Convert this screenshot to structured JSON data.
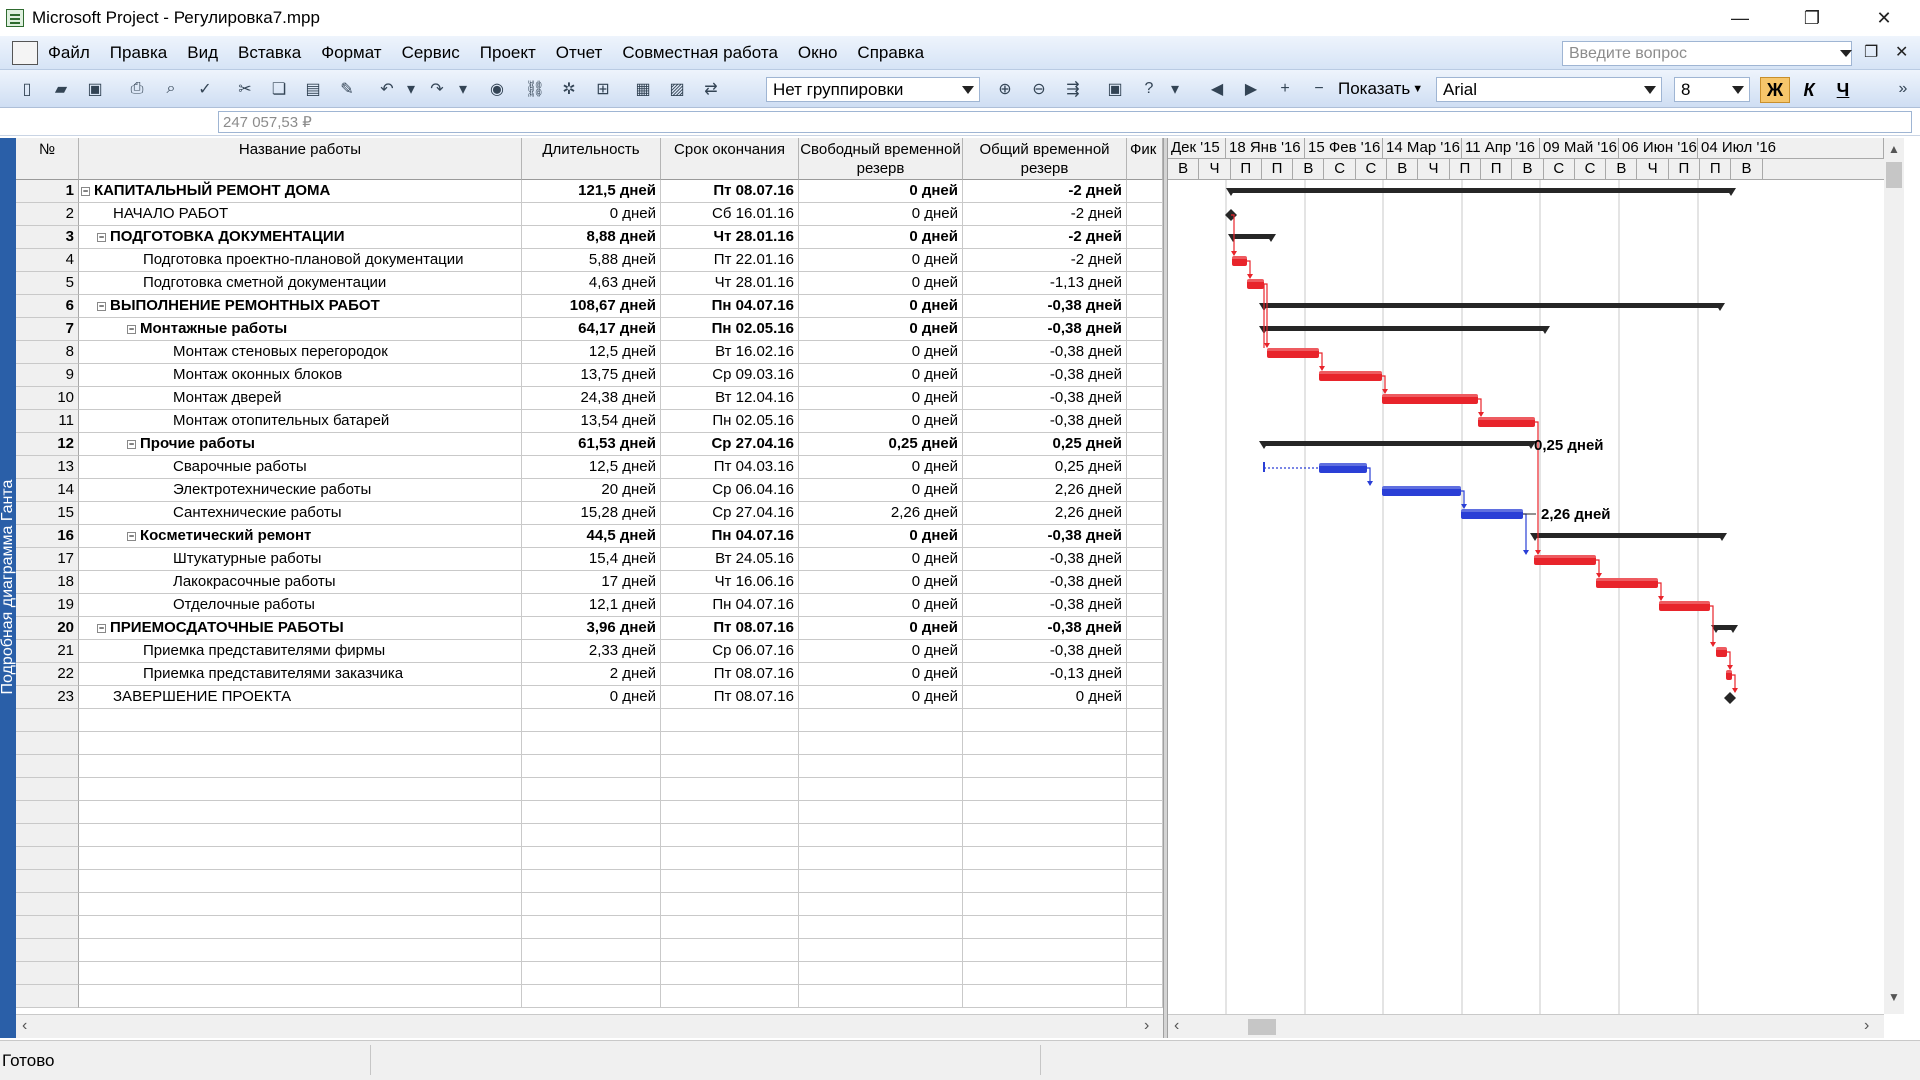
{
  "window": {
    "title": "Microsoft Project - Регулировка7.mpp",
    "buttons": [
      "—",
      "❐",
      "✕"
    ]
  },
  "menu": {
    "items": [
      "Файл",
      "Правка",
      "Вид",
      "Вставка",
      "Формат",
      "Сервис",
      "Проект",
      "Отчет",
      "Совместная работа",
      "Окно",
      "Справка"
    ],
    "ask_placeholder": "Введите вопрос"
  },
  "toolbar": {
    "grouping": "Нет группировки",
    "show_label": "Показать",
    "font_name": "Arial",
    "font_size": "8",
    "bold": "Ж",
    "italic": "К",
    "underline": "Ч"
  },
  "entry_bar": {
    "value": "247 057,53 ₽"
  },
  "view_bar": {
    "label": "Подробная диаграмма Ганта"
  },
  "grid": {
    "columns": [
      "№",
      "Название работы",
      "Длительность",
      "Срок окончания",
      "Свободный временной резерв",
      "Общий временной резерв",
      "Фик"
    ],
    "rows": [
      {
        "id": "1",
        "name": "КАПИТАЛЬНЫЙ РЕМОНТ ДОМА",
        "duration": "121,5 дней",
        "finish": "Пт 08.07.16",
        "free_slack": "0 дней",
        "total_slack": "-2 дней",
        "level": 0,
        "summary": true
      },
      {
        "id": "2",
        "name": "НАЧАЛО РАБОТ",
        "duration": "0 дней",
        "finish": "Сб 16.01.16",
        "free_slack": "0 дней",
        "total_slack": "-2 дней",
        "level": 1,
        "summary": false
      },
      {
        "id": "3",
        "name": "ПОДГОТОВКА ДОКУМЕНТАЦИИ",
        "duration": "8,88 дней",
        "finish": "Чт 28.01.16",
        "free_slack": "0 дней",
        "total_slack": "-2 дней",
        "level": 1,
        "summary": true
      },
      {
        "id": "4",
        "name": "Подготовка проектно-плановой документации",
        "duration": "5,88 дней",
        "finish": "Пт 22.01.16",
        "free_slack": "0 дней",
        "total_slack": "-2 дней",
        "level": 2,
        "summary": false
      },
      {
        "id": "5",
        "name": "Подготовка сметной документации",
        "duration": "4,63 дней",
        "finish": "Чт 28.01.16",
        "free_slack": "0 дней",
        "total_slack": "-1,13 дней",
        "level": 2,
        "summary": false
      },
      {
        "id": "6",
        "name": "ВЫПОЛНЕНИЕ РЕМОНТНЫХ РАБОТ",
        "duration": "108,67 дней",
        "finish": "Пн 04.07.16",
        "free_slack": "0 дней",
        "total_slack": "-0,38 дней",
        "level": 1,
        "summary": true
      },
      {
        "id": "7",
        "name": "Монтажные работы",
        "duration": "64,17 дней",
        "finish": "Пн 02.05.16",
        "free_slack": "0 дней",
        "total_slack": "-0,38 дней",
        "level": 2,
        "summary": true
      },
      {
        "id": "8",
        "name": "Монтаж стеновых перегородок",
        "duration": "12,5 дней",
        "finish": "Вт 16.02.16",
        "free_slack": "0 дней",
        "total_slack": "-0,38 дней",
        "level": 3,
        "summary": false
      },
      {
        "id": "9",
        "name": "Монтаж оконных блоков",
        "duration": "13,75 дней",
        "finish": "Ср 09.03.16",
        "free_slack": "0 дней",
        "total_slack": "-0,38 дней",
        "level": 3,
        "summary": false
      },
      {
        "id": "10",
        "name": "Монтаж дверей",
        "duration": "24,38 дней",
        "finish": "Вт 12.04.16",
        "free_slack": "0 дней",
        "total_slack": "-0,38 дней",
        "level": 3,
        "summary": false
      },
      {
        "id": "11",
        "name": "Монтаж отопительных батарей",
        "duration": "13,54 дней",
        "finish": "Пн 02.05.16",
        "free_slack": "0 дней",
        "total_slack": "-0,38 дней",
        "level": 3,
        "summary": false
      },
      {
        "id": "12",
        "name": "Прочие работы",
        "duration": "61,53 дней",
        "finish": "Ср 27.04.16",
        "free_slack": "0,25 дней",
        "total_slack": "0,25 дней",
        "level": 2,
        "summary": true
      },
      {
        "id": "13",
        "name": "Сварочные работы",
        "duration": "12,5 дней",
        "finish": "Пт 04.03.16",
        "free_slack": "0 дней",
        "total_slack": "0,25 дней",
        "level": 3,
        "summary": false
      },
      {
        "id": "14",
        "name": "Электротехнические работы",
        "duration": "20 дней",
        "finish": "Ср 06.04.16",
        "free_slack": "0 дней",
        "total_slack": "2,26 дней",
        "level": 3,
        "summary": false
      },
      {
        "id": "15",
        "name": "Сантехнические работы",
        "duration": "15,28 дней",
        "finish": "Ср 27.04.16",
        "free_slack": "2,26 дней",
        "total_slack": "2,26 дней",
        "level": 3,
        "summary": false
      },
      {
        "id": "16",
        "name": "Косметический ремонт",
        "duration": "44,5 дней",
        "finish": "Пн 04.07.16",
        "free_slack": "0 дней",
        "total_slack": "-0,38 дней",
        "level": 2,
        "summary": true
      },
      {
        "id": "17",
        "name": "Штукатурные работы",
        "duration": "15,4 дней",
        "finish": "Вт 24.05.16",
        "free_slack": "0 дней",
        "total_slack": "-0,38 дней",
        "level": 3,
        "summary": false
      },
      {
        "id": "18",
        "name": "Лакокрасочные работы",
        "duration": "17 дней",
        "finish": "Чт 16.06.16",
        "free_slack": "0 дней",
        "total_slack": "-0,38 дней",
        "level": 3,
        "summary": false
      },
      {
        "id": "19",
        "name": "Отделочные работы",
        "duration": "12,1 дней",
        "finish": "Пн 04.07.16",
        "free_slack": "0 дней",
        "total_slack": "-0,38 дней",
        "level": 3,
        "summary": false
      },
      {
        "id": "20",
        "name": "ПРИЕМОСДАТОЧНЫЕ РАБОТЫ",
        "duration": "3,96 дней",
        "finish": "Пт 08.07.16",
        "free_slack": "0 дней",
        "total_slack": "-0,38 дней",
        "level": 1,
        "summary": true
      },
      {
        "id": "21",
        "name": "Приемка представителями фирмы",
        "duration": "2,33 дней",
        "finish": "Ср 06.07.16",
        "free_slack": "0 дней",
        "total_slack": "-0,38 дней",
        "level": 2,
        "summary": false
      },
      {
        "id": "22",
        "name": "Приемка представителями заказчика",
        "duration": "2 дней",
        "finish": "Пт 08.07.16",
        "free_slack": "0 дней",
        "total_slack": "-0,13 дней",
        "level": 2,
        "summary": false
      },
      {
        "id": "23",
        "name": "ЗАВЕРШЕНИЕ ПРОЕКТА",
        "duration": "0 дней",
        "finish": "Пт 08.07.16",
        "free_slack": "0 дней",
        "total_slack": "0 дней",
        "level": 1,
        "summary": false
      }
    ],
    "empty_rows": 13
  },
  "gantt": {
    "timescale_top": [
      "Дек '15",
      "18 Янв '16",
      "15 Фев '16",
      "14 Мар '16",
      "11 Апр '16",
      "09 Май '16",
      "06 Июн '16",
      "04 Июл '16"
    ],
    "timescale_bottom": [
      "В",
      "Ч",
      "П",
      "П",
      "В",
      "С",
      "С",
      "В",
      "Ч",
      "П",
      "П",
      "В",
      "С",
      "С",
      "В",
      "Ч",
      "П",
      "П",
      "В"
    ],
    "slack_labels": {
      "12": "0,25 дней",
      "15": "2,26 дней"
    },
    "colors": {
      "critical": "#e8242b",
      "noncritical": "#2a3fd6",
      "summary": "#262626",
      "link_critical": "#e8242b",
      "link_noncritical": "#2a3fd6"
    }
  },
  "status": {
    "text": "Готово"
  }
}
